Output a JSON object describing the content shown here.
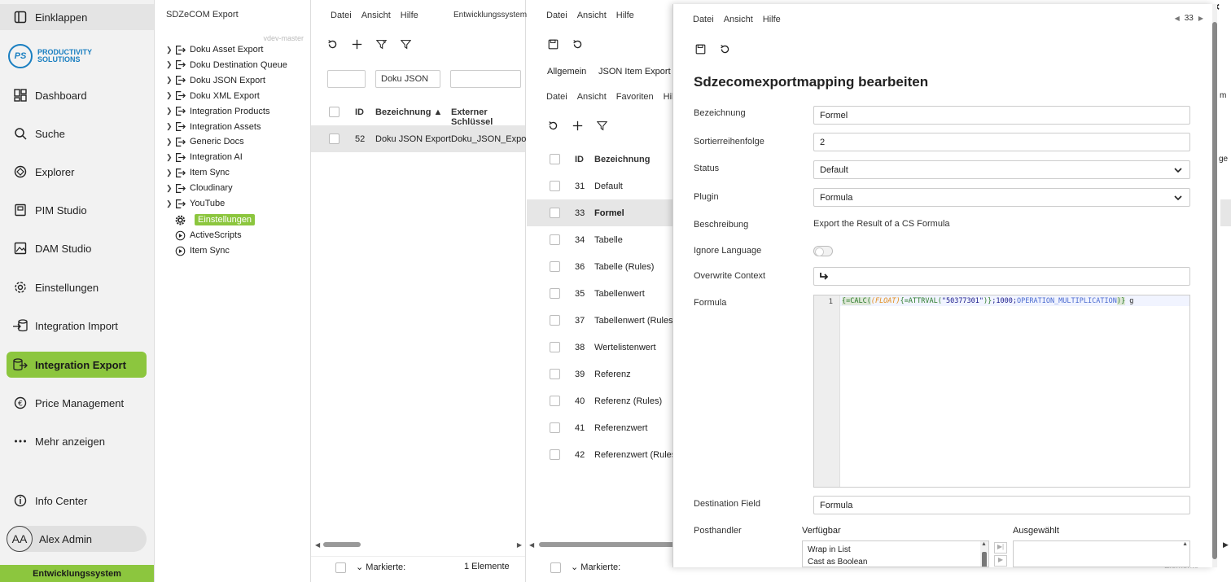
{
  "nav": {
    "collapse_label": "Einklappen",
    "logo_initials": "PS",
    "logo_line1": "PRODUCTIVITY",
    "logo_line2": "SOLUTIONS",
    "items": [
      {
        "label": "Dashboard",
        "icon": "dashboard-icon"
      },
      {
        "label": "Suche",
        "icon": "search-icon"
      },
      {
        "label": "Explorer",
        "icon": "explorer-icon"
      },
      {
        "label": "PIM Studio",
        "icon": "pim-icon"
      },
      {
        "label": "DAM Studio",
        "icon": "image-icon"
      },
      {
        "label": "Einstellungen",
        "icon": "gear-icon"
      },
      {
        "label": "Integration Import",
        "icon": "import-icon"
      },
      {
        "label": "Integration Export",
        "icon": "export-icon"
      },
      {
        "label": "Price Management",
        "icon": "euro-icon"
      },
      {
        "label": "Mehr anzeigen",
        "icon": "more-icon"
      }
    ],
    "info_center": "Info Center",
    "user_initials": "AA",
    "user_name": "Alex Admin",
    "env_label": "Entwicklungssystem",
    "accent": "#8cc63e"
  },
  "tree": {
    "header": "SDZeCOM Export",
    "branch": "vdev-master",
    "items": [
      "Doku Asset Export",
      "Doku Destination Queue",
      "Doku JSON Export",
      "Doku XML Export",
      "Integration Products",
      "Integration Assets",
      "Generic Docs",
      "Integration AI",
      "Item Sync",
      "Cloudinary",
      "YouTube"
    ],
    "settings_item": "Einstellungen",
    "extra_items": [
      "ActiveScripts",
      "Item Sync"
    ]
  },
  "panel1": {
    "menu": [
      "Datei",
      "Ansicht",
      "Hilfe"
    ],
    "env": "Entwicklungssystem",
    "filter_bezeichnung": "Doku JSON",
    "columns": {
      "id": "ID",
      "name": "Bezeichnung ▲",
      "key": "Externer Schlüssel"
    },
    "rows": [
      {
        "id": "52",
        "name": "Doku JSON Export",
        "key": "Doku_JSON_Export"
      }
    ],
    "footer_marked": "Markierte:",
    "footer_count": "1 Elemente"
  },
  "panel2": {
    "menu": [
      "Datei",
      "Ansicht",
      "Hilfe"
    ],
    "tabs": [
      "Allgemein",
      "JSON Item Export"
    ],
    "submenu": [
      "Datei",
      "Ansicht",
      "Favoriten",
      "Hilfe"
    ],
    "columns": {
      "id": "ID",
      "name": "Bezeichnung"
    },
    "rows": [
      {
        "id": "31",
        "name": "Default"
      },
      {
        "id": "33",
        "name": "Formel"
      },
      {
        "id": "34",
        "name": "Tabelle"
      },
      {
        "id": "36",
        "name": "Tabelle (Rules)"
      },
      {
        "id": "35",
        "name": "Tabellenwert"
      },
      {
        "id": "37",
        "name": "Tabellenwert (Rules)"
      },
      {
        "id": "38",
        "name": "Wertelistenwert"
      },
      {
        "id": "39",
        "name": "Referenz"
      },
      {
        "id": "40",
        "name": "Referenz (Rules)"
      },
      {
        "id": "41",
        "name": "Referenzwert"
      },
      {
        "id": "42",
        "name": "Referenzwert (Rules)"
      }
    ],
    "selected_id": "33",
    "footer_marked": "Markierte:"
  },
  "dialog": {
    "menu": [
      "Datei",
      "Ansicht",
      "Hilfe"
    ],
    "record_number": "33",
    "title": "Sdzecomexportmapping bearbeiten",
    "fields": {
      "bezeichnung_label": "Bezeichnung",
      "bezeichnung_value": "Formel",
      "sort_label": "Sortierreihenfolge",
      "sort_value": "2",
      "status_label": "Status",
      "status_value": "Default",
      "plugin_label": "Plugin",
      "plugin_value": "Formula",
      "beschreibung_label": "Beschreibung",
      "beschreibung_value": "Export the Result of a CS Formula",
      "ignore_language_label": "Ignore Language",
      "overwrite_context_label": "Overwrite Context",
      "formula_label": "Formula",
      "formula_line_no": "1",
      "formula_parts": {
        "p1": "{=CALC(",
        "p2": "(FLOAT)",
        "p3": "{=ATTRVAL(",
        "p4": "\"50377301\"",
        "p5": ")}",
        "p6": ";1000;",
        "p7": "OPERATION_MULTIPLICATION",
        "p8": ")}",
        "p9": " g"
      },
      "destination_label": "Destination Field",
      "destination_value": "Formula",
      "posthandler_label": "Posthandler",
      "available_label": "Verfügbar",
      "selected_label": "Ausgewählt",
      "available_items": [
        "Wrap in List",
        "Cast as Boolean"
      ]
    }
  },
  "background_right": {
    "letter_m": "m",
    "letters_ge": "ge",
    "count_fragment": "Elemente"
  }
}
